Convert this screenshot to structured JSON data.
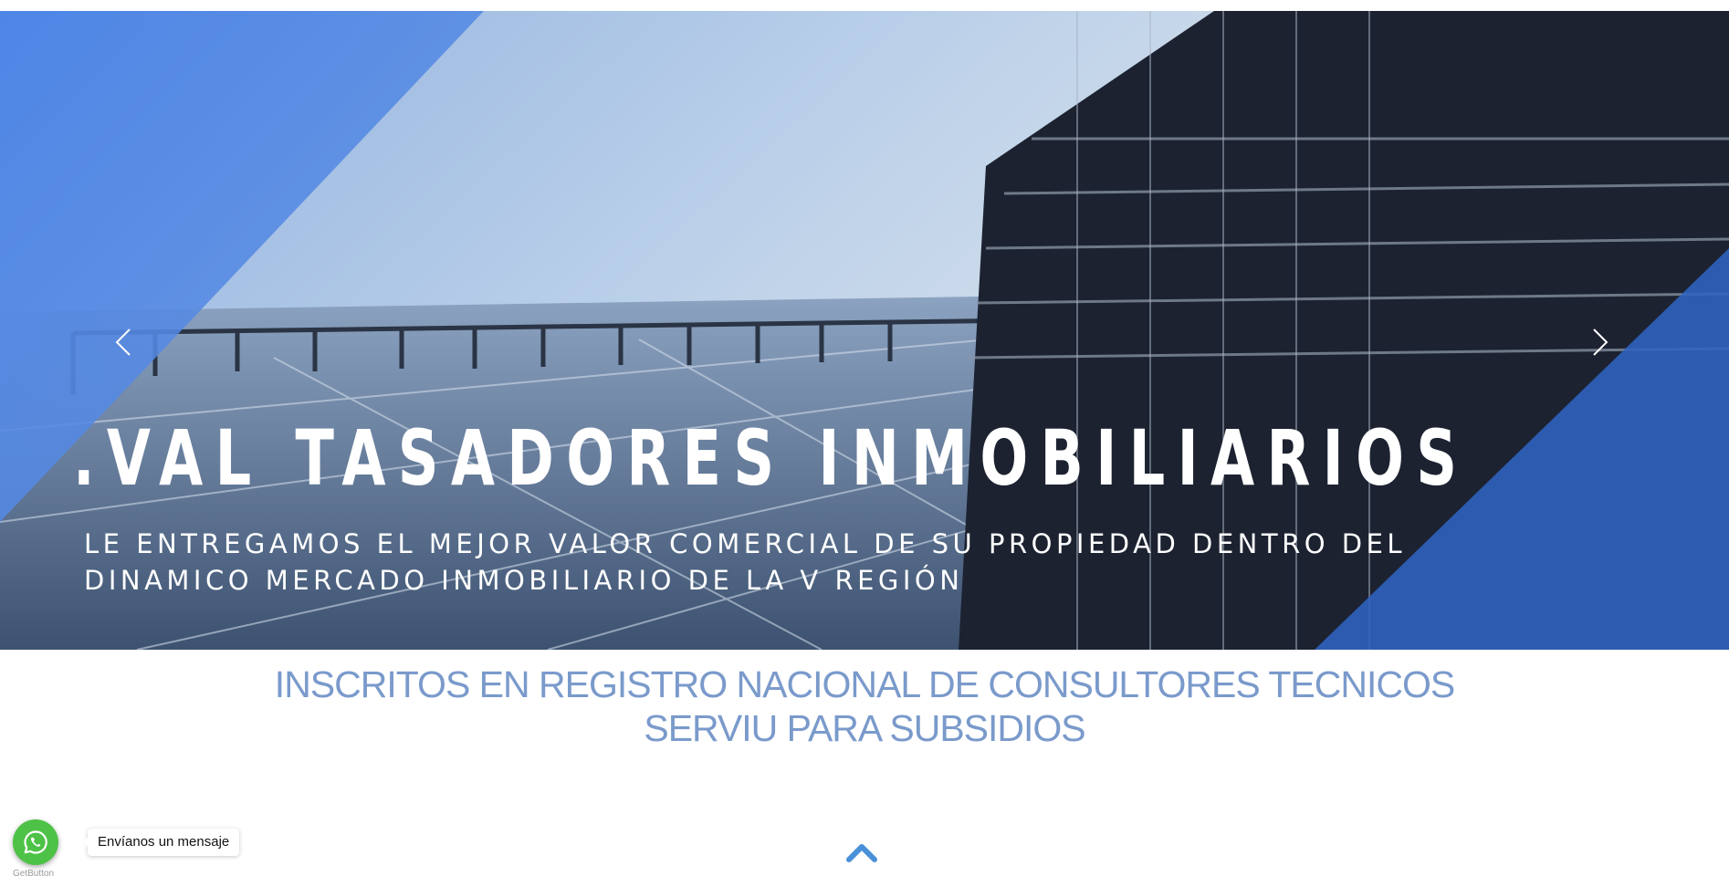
{
  "hero": {
    "title": ".VAL TASADORES INMOBILIARIOS",
    "subtitle": "LE ENTREGAMOS EL MEJOR VALOR COMERCIAL DE SU PROPIEDAD DENTRO DEL DINAMICO MERCADO INMOBILIARIO DE LA V REGIÓN",
    "prev_icon": "chevron-left-icon",
    "next_icon": "chevron-right-icon"
  },
  "main": {
    "heading_line1": "INSCRITOS EN REGISTRO NACIONAL DE CONSULTORES TECNICOS",
    "heading_line2": "SERVIU PARA SUBSIDIOS"
  },
  "scroll_top": {
    "icon": "chevron-up-icon"
  },
  "whatsapp": {
    "icon": "whatsapp-icon",
    "label": "Envíanos un mensaje",
    "credit": "GetButton"
  },
  "colors": {
    "heading": "#7a9acb",
    "accent_blue": "#2f63c0",
    "scroll_top": "#4a90d9",
    "whatsapp": "#4dc247"
  }
}
